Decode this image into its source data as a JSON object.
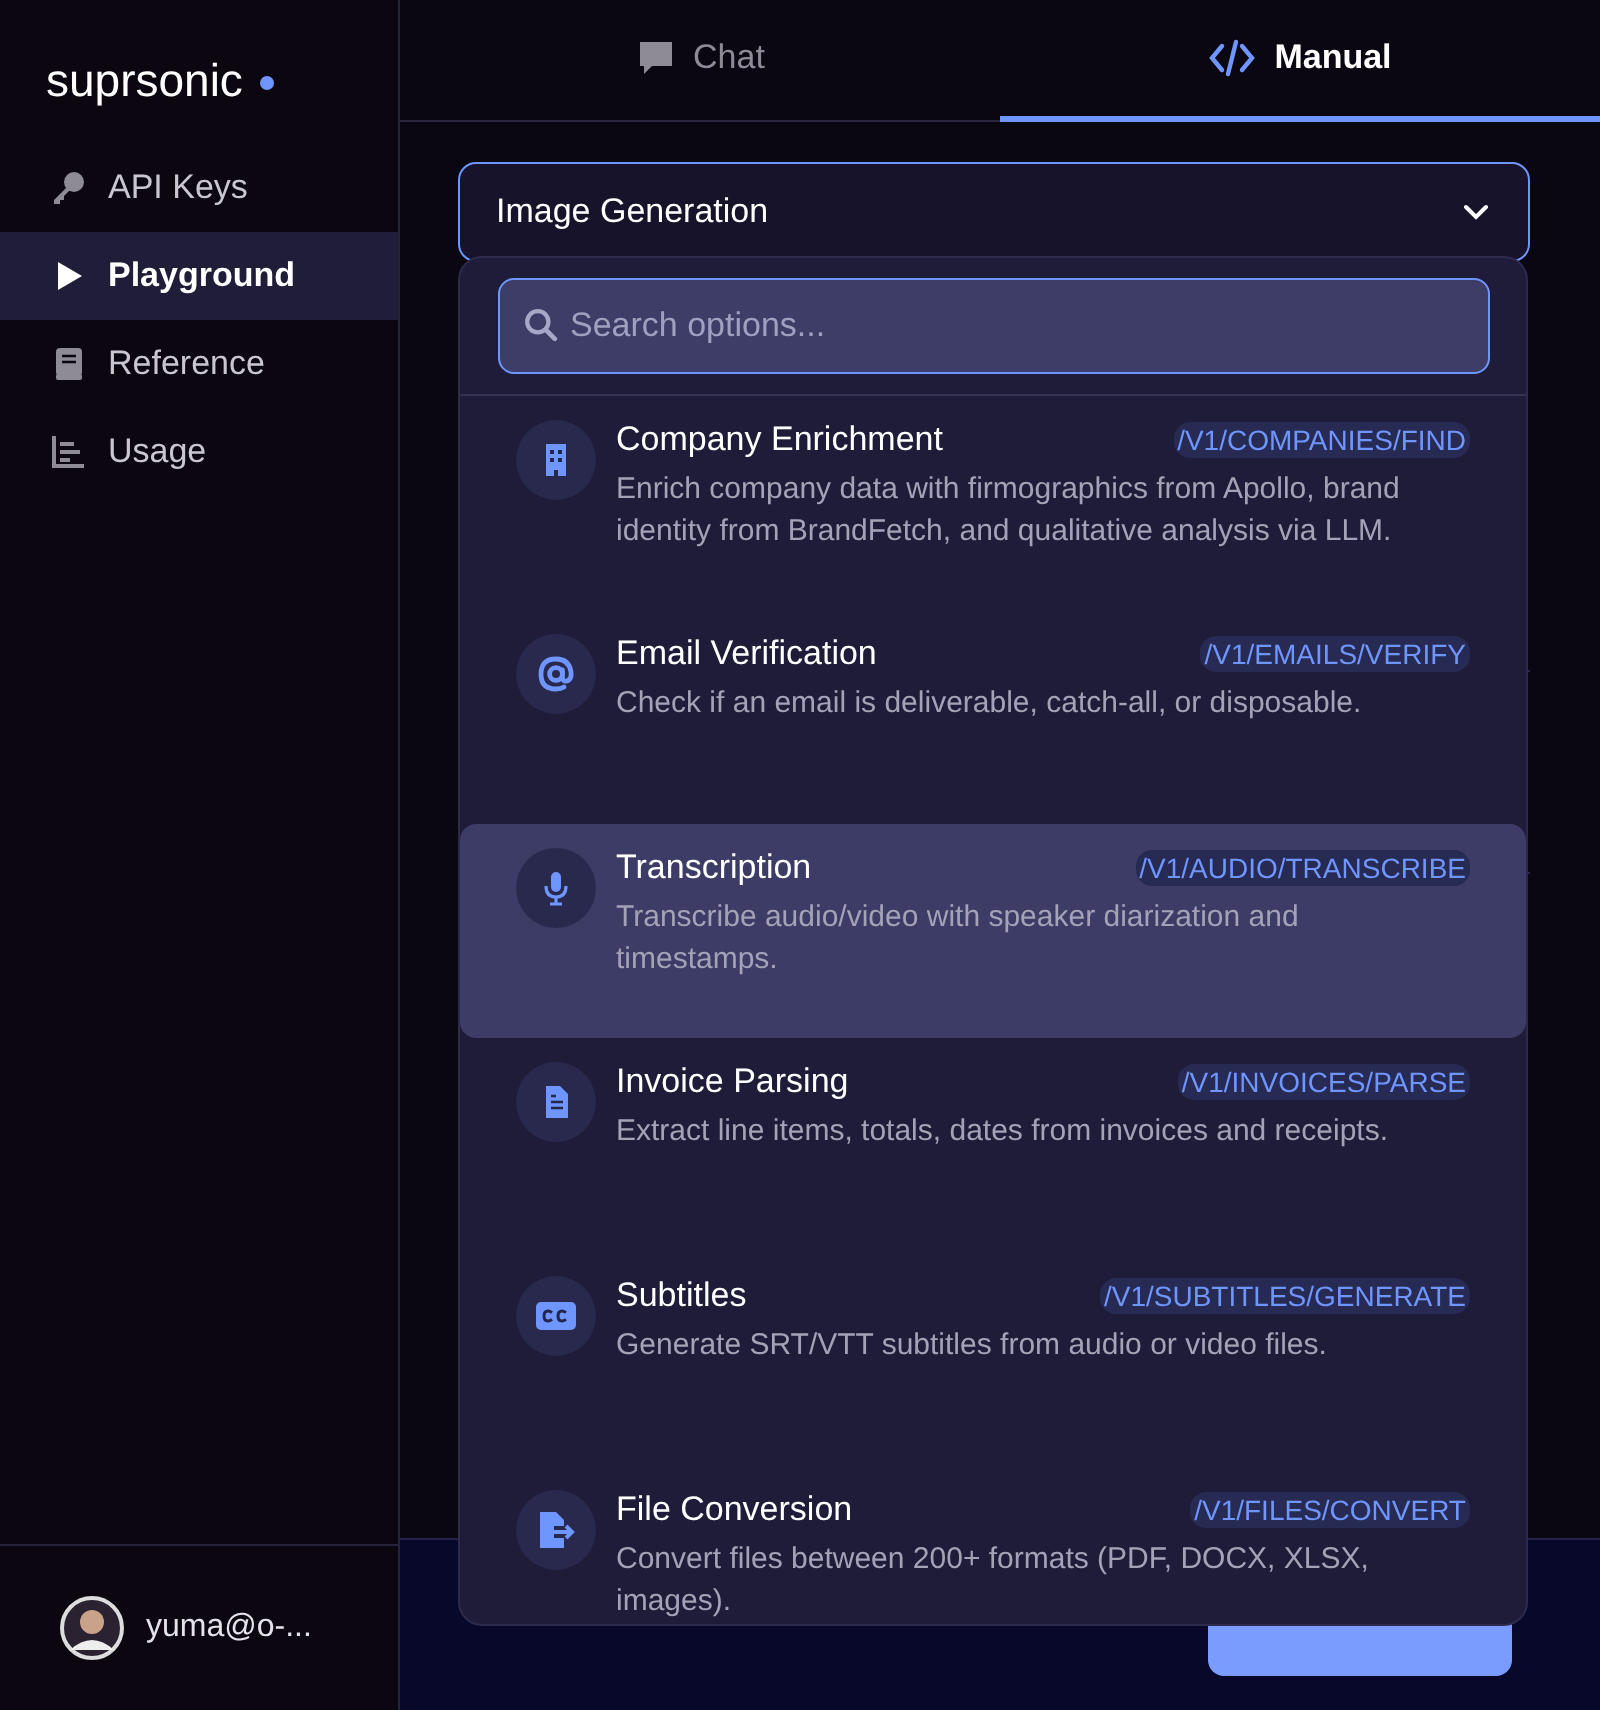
{
  "sidebar": {
    "brand": "suprsonic",
    "items": [
      {
        "label": "API Keys",
        "selected": false
      },
      {
        "label": "Playground",
        "selected": true
      },
      {
        "label": "Reference",
        "selected": false
      },
      {
        "label": "Usage",
        "selected": false
      }
    ],
    "user": {
      "email": "yuma@o-..."
    }
  },
  "tabs": [
    {
      "label": "Chat",
      "selected": false
    },
    {
      "label": "Manual",
      "selected": true
    }
  ],
  "select": {
    "value": "Image Generation",
    "expanded": true
  },
  "dropdown": {
    "search": {
      "placeholder": "Search options..."
    },
    "options": [
      {
        "title": "Company Enrichment",
        "endpoint": "/V1/COMPANIES/FIND",
        "description": "Enrich company data with firmographics from Apollo, brand identity from BrandFetch, and qualitative analysis via LLM.",
        "selected": false
      },
      {
        "title": "Email Verification",
        "endpoint": "/V1/EMAILS/VERIFY",
        "description": "Check if an email is deliverable, catch-all, or disposable.",
        "selected": false
      },
      {
        "title": "Transcription",
        "endpoint": "/V1/AUDIO/TRANSCRIBE",
        "description": "Transcribe audio/video with speaker diarization and timestamps.",
        "selected": true
      },
      {
        "title": "Invoice Parsing",
        "endpoint": "/V1/INVOICES/PARSE",
        "description": "Extract line items, totals, dates from invoices and receipts.",
        "selected": false
      },
      {
        "title": "Subtitles",
        "endpoint": "/V1/SUBTITLES/GENERATE",
        "description": "Generate SRT/VTT subtitles from audio or video files.",
        "selected": false
      },
      {
        "title": "File Conversion",
        "endpoint": "/V1/FILES/CONVERT",
        "description": "Convert files between 200+ formats (PDF, DOCX, XLSX, images).",
        "selected": false
      }
    ]
  }
}
